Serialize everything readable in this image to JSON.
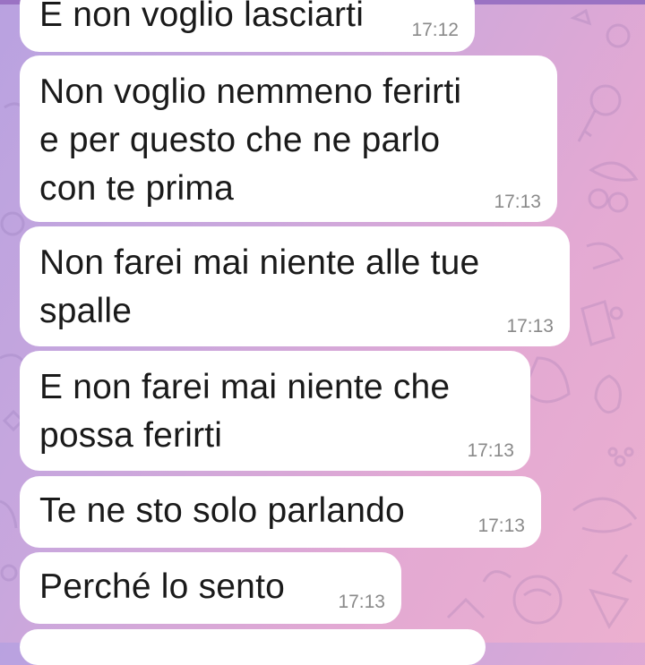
{
  "colors": {
    "bubble_bg": "#ffffff",
    "text": "#1a1a1a",
    "timestamp": "#8a8a8a",
    "wallpaper_start": "#b9a2e0",
    "wallpaper_end": "#ecb0cf"
  },
  "messages": [
    {
      "text": "E non voglio lasciarti",
      "time": "17:12"
    },
    {
      "text": "Non voglio nemmeno ferirti\ne per questo che ne parlo\ncon te prima",
      "time": "17:13"
    },
    {
      "text": "Non farei mai niente alle tue\nspalle",
      "time": "17:13"
    },
    {
      "text": "E non farei mai niente che\npossa ferirti",
      "time": "17:13"
    },
    {
      "text": "Te ne sto solo parlando",
      "time": "17:13"
    },
    {
      "text": "Perché lo sento",
      "time": "17:13"
    }
  ]
}
